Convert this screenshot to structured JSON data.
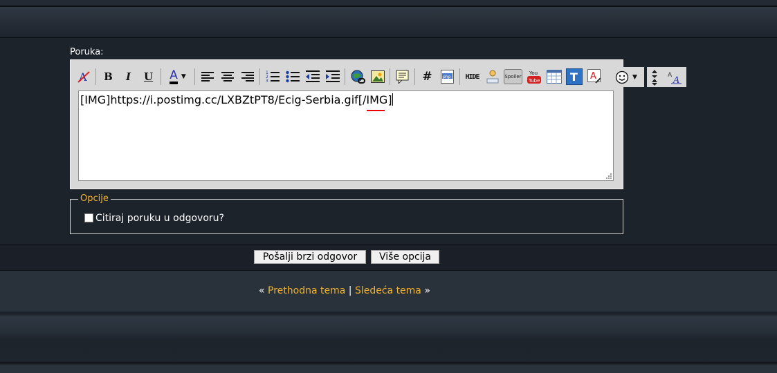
{
  "form": {
    "message_label": "Poruka:",
    "message_text": "[IMG]https://i.postimg.cc/LXBZtPT8/Ecig-Serbia.gif[/IMG]",
    "options_legend": "Opcije",
    "quote_label": "Citiraj poruku u odgovoru?"
  },
  "toolbar": {
    "items": [
      "remove-format",
      "bold",
      "italic",
      "underline",
      "font-color",
      "align-left",
      "align-center",
      "align-right",
      "ordered-list",
      "unordered-list",
      "outdent",
      "indent",
      "insert-link",
      "insert-image",
      "quote",
      "code",
      "php",
      "hide",
      "spoiler-hider",
      "spoiler",
      "youtube",
      "table",
      "text-box",
      "highlight",
      "smilies",
      "resize",
      "typography"
    ],
    "bold_label": "B",
    "italic_label": "I",
    "underline_label": "U",
    "font_color_label": "A",
    "code_label": "#",
    "hide_label": "HIDE",
    "spoiler_label": "Spoiler",
    "youtube_label": "You Tube",
    "textbox_label": "T"
  },
  "buttons": {
    "send": "Pošalji brzi odgovor",
    "more": "Više opcija"
  },
  "nav": {
    "prev_arrow": "«",
    "prev": "Prethodna tema",
    "separator": "|",
    "next": "Sledeća tema",
    "next_arrow": "»"
  },
  "colors": {
    "background": "#1d232b",
    "link": "#f0b332"
  }
}
